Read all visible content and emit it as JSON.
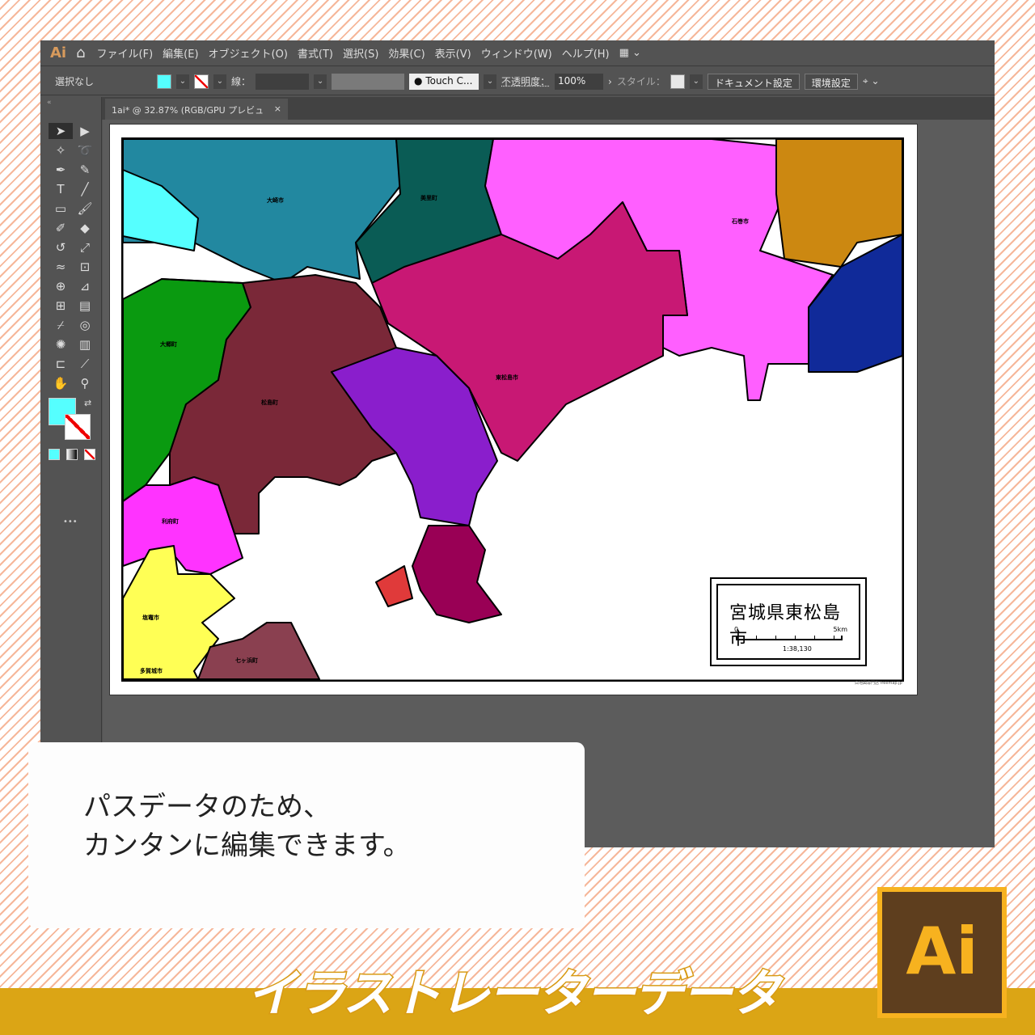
{
  "app": {
    "logo": "Ai",
    "menu": [
      "ファイル(F)",
      "編集(E)",
      "オブジェクト(O)",
      "書式(T)",
      "選択(S)",
      "効果(C)",
      "表示(V)",
      "ウィンドウ(W)",
      "ヘルプ(H)"
    ]
  },
  "control": {
    "selection": "選択なし",
    "stroke_label": "線：",
    "brush": "Touch C...",
    "opacity_label": "不透明度：",
    "opacity": "100%",
    "style_label": "スタイル：",
    "doc_settings": "ドキュメント設定",
    "prefs": "環境設定",
    "fill_color": "#55ffff"
  },
  "tab": {
    "title": "1ai* @ 32.87% (RGB/GPU プレビュー)",
    "close": "×"
  },
  "toolbar": {
    "tools": [
      "selection",
      "direct-selection",
      "magic-wand",
      "lasso",
      "pen",
      "curvature",
      "type",
      "line",
      "rectangle",
      "paintbrush",
      "shaper",
      "eraser",
      "rotate",
      "scale",
      "warp",
      "free-transform",
      "shape-builder",
      "perspective",
      "mesh",
      "gradient",
      "eyedropper",
      "blend",
      "symbol-sprayer",
      "graph",
      "artboard",
      "slice",
      "hand",
      "zoom"
    ],
    "more": "•••"
  },
  "map": {
    "title": "宮城県東松島市",
    "scale_start": "0",
    "scale_end": "5km",
    "scale_ratio": "1:38,130",
    "credit": "白地図専門店 freemap.jp",
    "labels": [
      "大崎市",
      "美里町",
      "石巻市",
      "大郷町",
      "松島町",
      "東松島市",
      "利府町",
      "塩竈市",
      "多賀城市",
      "七ヶ浜町"
    ],
    "colors": {
      "osaki": "#2288a0",
      "misato": "#0a5c55",
      "ishinomaki": "#ff5fff",
      "higashimatsushima": "#c81874",
      "taigo": "#0a9a10",
      "matsushima": "#7a2838",
      "rifu": "#ff33ff",
      "shiogama": "#ffff55",
      "shichigahama": "#8a4050"
    }
  },
  "card": {
    "line1": "パスデータのため、",
    "line2": "カンタンに編集できます。"
  },
  "banner": {
    "title": "イラストレーターデータ",
    "logo": "Ai"
  }
}
